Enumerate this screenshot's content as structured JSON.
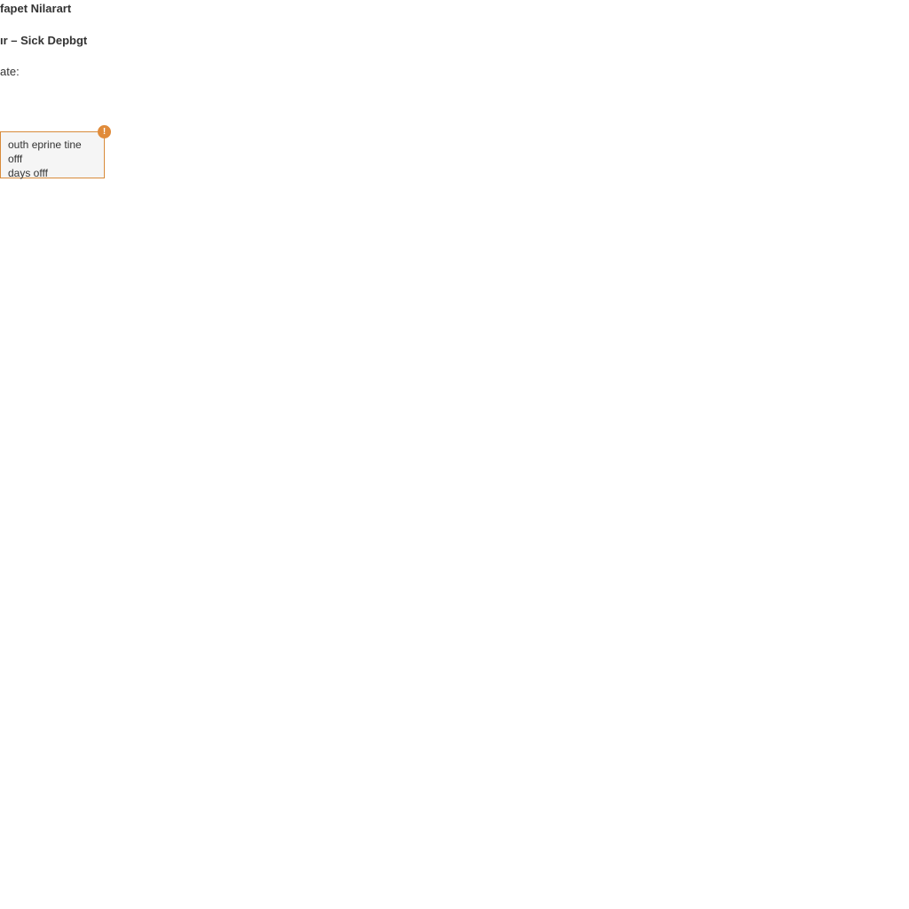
{
  "header": {
    "title": "fapet Nilarart"
  },
  "section": {
    "subtitle": "ır – Sick Depbgt",
    "date_label": "ate:"
  },
  "warning": {
    "line1": "outh eprine tine offf",
    "line2": "days offf",
    "badge": "!"
  }
}
